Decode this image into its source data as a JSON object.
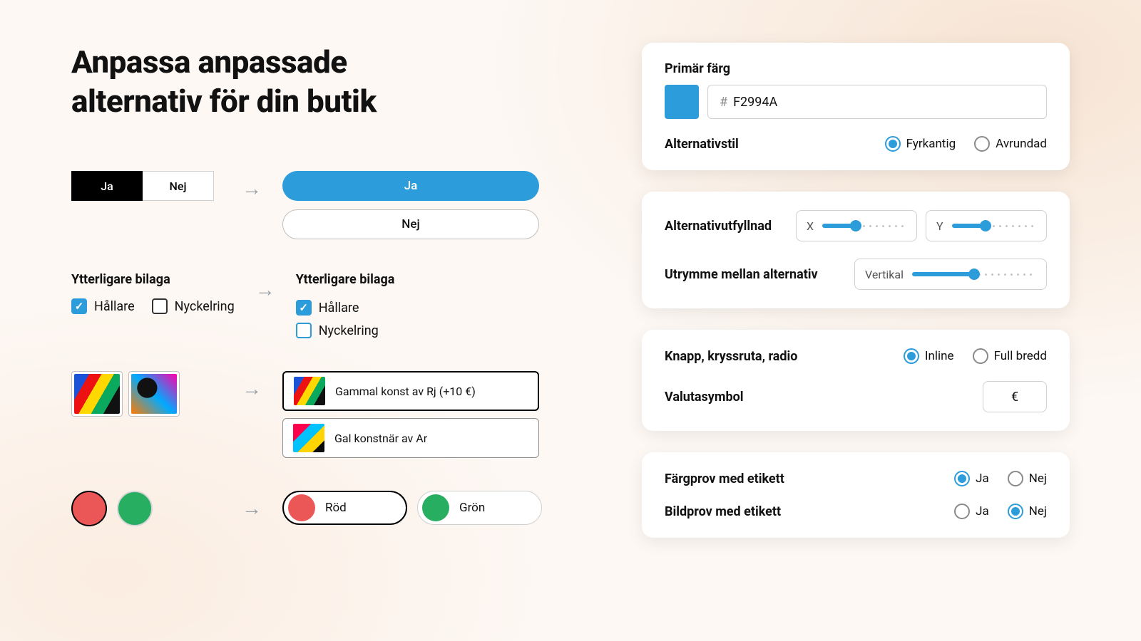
{
  "title": "Anpassa anpassade alternativ för din butik",
  "examples": {
    "yesno": {
      "yes": "Ja",
      "no": "Nej"
    },
    "attach": {
      "heading": "Ytterligare bilaga",
      "opt1": "Hållare",
      "opt2": "Nyckelring"
    },
    "image": {
      "row1": "Gammal konst av Rj (+10 €)",
      "row2": "Gal konstnär av Ar"
    },
    "color": {
      "red": "Röd",
      "green": "Grön"
    }
  },
  "settings": {
    "primaryColor": {
      "label": "Primär färg",
      "value": "F2994A",
      "hash": "#"
    },
    "optionStyle": {
      "label": "Alternativstil",
      "square": "Fyrkantig",
      "rounded": "Avrundad",
      "selected": "square"
    },
    "padding": {
      "label": "Alternativutfyllnad",
      "x": "X",
      "y": "Y",
      "xFill": 40,
      "yFill": 40
    },
    "gap": {
      "label": "Utrymme mellan alternativ",
      "axis": "Vertikal",
      "fill": 50
    },
    "layout": {
      "label": "Knapp, kryssruta, radio",
      "inline": "Inline",
      "full": "Full bredd",
      "selected": "inline"
    },
    "currency": {
      "label": "Valutasymbol",
      "value": "€"
    },
    "swatchLabel": {
      "label": "Färgprov med etikett",
      "yes": "Ja",
      "no": "Nej",
      "selected": "yes"
    },
    "imageLabel": {
      "label": "Bildprov med etikett",
      "yes": "Ja",
      "no": "Nej",
      "selected": "no"
    }
  }
}
